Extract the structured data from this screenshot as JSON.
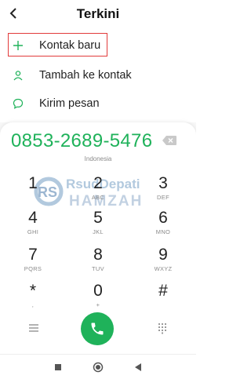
{
  "header": {
    "title": "Terkini",
    "back_icon": "chevron-left-icon"
  },
  "actions": [
    {
      "label": "Kontak baru",
      "icon": "plus-icon"
    },
    {
      "label": "Tambah ke kontak",
      "icon": "person-icon"
    },
    {
      "label": "Kirim pesan",
      "icon": "message-bubble-icon"
    }
  ],
  "dialer": {
    "number": "0853-2689-5476",
    "country": "Indonesia",
    "accent_color": "#1fb25a",
    "keys": [
      {
        "digit": "1",
        "letters": ""
      },
      {
        "digit": "2",
        "letters": "ABC"
      },
      {
        "digit": "3",
        "letters": "DEF"
      },
      {
        "digit": "4",
        "letters": "GHI"
      },
      {
        "digit": "5",
        "letters": "JKL"
      },
      {
        "digit": "6",
        "letters": "MNO"
      },
      {
        "digit": "7",
        "letters": "PQRS"
      },
      {
        "digit": "8",
        "letters": "TUV"
      },
      {
        "digit": "9",
        "letters": "WXYZ"
      },
      {
        "digit": "*",
        "letters": ","
      },
      {
        "digit": "0",
        "letters": "+"
      },
      {
        "digit": "#",
        "letters": ""
      }
    ]
  },
  "watermark": {
    "line1": "RsudDepati",
    "line2": "HAMZAH",
    "mark": "RS"
  },
  "highlight_color": "#e23b3b"
}
